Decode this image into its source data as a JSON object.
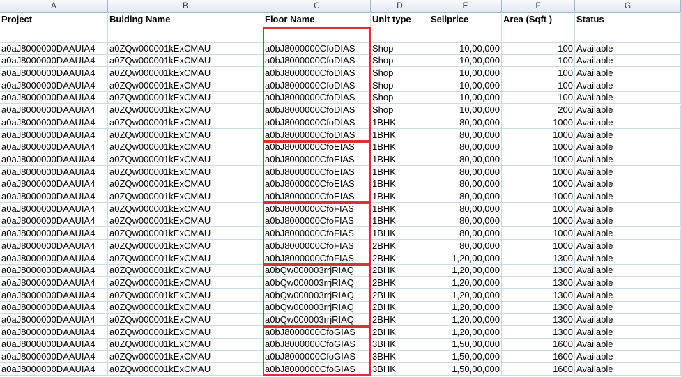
{
  "columns": [
    "A",
    "B",
    "C",
    "D",
    "E",
    "F",
    "G"
  ],
  "headers": [
    "Project",
    "Buiding Name",
    "Floor Name",
    "Unit type",
    "Sellprice",
    "Area (Sqft )",
    "Status"
  ],
  "rows": [
    [
      "a0aJ8000000DAAUIA4",
      "a0ZQw000001kExCMAU",
      "a0bJ8000000CfoDIAS",
      "Shop",
      "10,00,000",
      "100",
      "Available"
    ],
    [
      "a0aJ8000000DAAUIA4",
      "a0ZQw000001kExCMAU",
      "a0bJ8000000CfoDIAS",
      "Shop",
      "10,00,000",
      "100",
      "Available"
    ],
    [
      "a0aJ8000000DAAUIA4",
      "a0ZQw000001kExCMAU",
      "a0bJ8000000CfoDIAS",
      "Shop",
      "10,00,000",
      "100",
      "Available"
    ],
    [
      "a0aJ8000000DAAUIA4",
      "a0ZQw000001kExCMAU",
      "a0bJ8000000CfoDIAS",
      "Shop",
      "10,00,000",
      "100",
      "Available"
    ],
    [
      "a0aJ8000000DAAUIA4",
      "a0ZQw000001kExCMAU",
      "a0bJ8000000CfoDIAS",
      "Shop",
      "10,00,000",
      "100",
      "Available"
    ],
    [
      "a0aJ8000000DAAUIA4",
      "a0ZQw000001kExCMAU",
      "a0bJ8000000CfoDIAS",
      "Shop",
      "10,00,000",
      "200",
      "Available"
    ],
    [
      "a0aJ8000000DAAUIA4",
      "a0ZQw000001kExCMAU",
      "a0bJ8000000CfoDIAS",
      "1BHK",
      "80,00,000",
      "1000",
      "Available"
    ],
    [
      "a0aJ8000000DAAUIA4",
      "a0ZQw000001kExCMAU",
      "a0bJ8000000CfoDIAS",
      "1BHK",
      "80,00,000",
      "1000",
      "Available"
    ],
    [
      "a0aJ8000000DAAUIA4",
      "a0ZQw000001kExCMAU",
      "a0bJ8000000CfoEIAS",
      "1BHK",
      "80,00,000",
      "1000",
      "Available"
    ],
    [
      "a0aJ8000000DAAUIA4",
      "a0ZQw000001kExCMAU",
      "a0bJ8000000CfoEIAS",
      "1BHK",
      "80,00,000",
      "1000",
      "Available"
    ],
    [
      "a0aJ8000000DAAUIA4",
      "a0ZQw000001kExCMAU",
      "a0bJ8000000CfoEIAS",
      "1BHK",
      "80,00,000",
      "1000",
      "Available"
    ],
    [
      "a0aJ8000000DAAUIA4",
      "a0ZQw000001kExCMAU",
      "a0bJ8000000CfoEIAS",
      "1BHK",
      "80,00,000",
      "1000",
      "Available"
    ],
    [
      "a0aJ8000000DAAUIA4",
      "a0ZQw000001kExCMAU",
      "a0bJ8000000CfoEIAS",
      "1BHK",
      "80,00,000",
      "1000",
      "Available"
    ],
    [
      "a0aJ8000000DAAUIA4",
      "a0ZQw000001kExCMAU",
      "a0bJ8000000CfoFIAS",
      "1BHK",
      "80,00,000",
      "1000",
      "Available"
    ],
    [
      "a0aJ8000000DAAUIA4",
      "a0ZQw000001kExCMAU",
      "a0bJ8000000CfoFIAS",
      "1BHK",
      "80,00,000",
      "1000",
      "Available"
    ],
    [
      "a0aJ8000000DAAUIA4",
      "a0ZQw000001kExCMAU",
      "a0bJ8000000CfoFIAS",
      "1BHK",
      "80,00,000",
      "1000",
      "Available"
    ],
    [
      "a0aJ8000000DAAUIA4",
      "a0ZQw000001kExCMAU",
      "a0bJ8000000CfoFIAS",
      "2BHK",
      "80,00,000",
      "1000",
      "Available"
    ],
    [
      "a0aJ8000000DAAUIA4",
      "a0ZQw000001kExCMAU",
      "a0bJ8000000CfoFIAS",
      "2BHK",
      "1,20,00,000",
      "1300",
      "Available"
    ],
    [
      "a0aJ8000000DAAUIA4",
      "a0ZQw000001kExCMAU",
      "a0bQw000003rrjRIAQ",
      "2BHK",
      "1,20,00,000",
      "1300",
      "Available"
    ],
    [
      "a0aJ8000000DAAUIA4",
      "a0ZQw000001kExCMAU",
      "a0bQw000003rrjRIAQ",
      "2BHK",
      "1,20,00,000",
      "1300",
      "Available"
    ],
    [
      "a0aJ8000000DAAUIA4",
      "a0ZQw000001kExCMAU",
      "a0bQw000003rrjRIAQ",
      "2BHK",
      "1,20,00,000",
      "1300",
      "Available"
    ],
    [
      "a0aJ8000000DAAUIA4",
      "a0ZQw000001kExCMAU",
      "a0bQw000003rrjRIAQ",
      "2BHK",
      "1,20,00,000",
      "1300",
      "Available"
    ],
    [
      "a0aJ8000000DAAUIA4",
      "a0ZQw000001kExCMAU",
      "a0bQw000003rrjRIAQ",
      "2BHK",
      "1,20,00,000",
      "1300",
      "Available"
    ],
    [
      "a0aJ8000000DAAUIA4",
      "a0ZQw000001kExCMAU",
      "a0bJ8000000CfoGIAS",
      "2BHK",
      "1,20,00,000",
      "1300",
      "Available"
    ],
    [
      "a0aJ8000000DAAUIA4",
      "a0ZQw000001kExCMAU",
      "a0bJ8000000CfoGIAS",
      "3BHK",
      "1,50,00,000",
      "1600",
      "Available"
    ],
    [
      "a0aJ8000000DAAUIA4",
      "a0ZQw000001kExCMAU",
      "a0bJ8000000CfoGIAS",
      "3BHK",
      "1,50,00,000",
      "1600",
      "Available"
    ],
    [
      "a0aJ8000000DAAUIA4",
      "a0ZQw000001kExCMAU",
      "a0bJ8000000CfoGIAS",
      "3BHK",
      "1,50,00,000",
      "1600",
      "Available"
    ]
  ],
  "colors": {
    "highlight_border": "#d9313a",
    "gridline": "#d0d7e5",
    "header_text": "#27415f"
  }
}
